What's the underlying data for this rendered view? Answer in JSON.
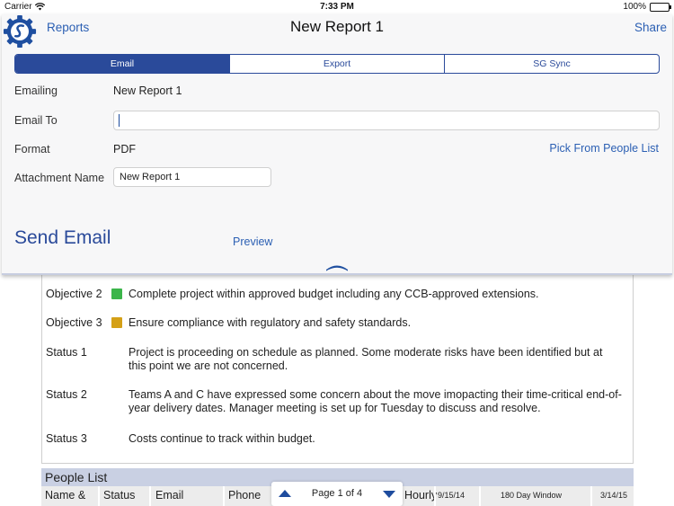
{
  "status_bar": {
    "carrier": "Carrier",
    "time": "7:33 PM",
    "battery": "100%"
  },
  "nav": {
    "back": "Reports",
    "title": "New Report 1",
    "share": "Share"
  },
  "tabs": [
    {
      "label": "Email",
      "active": true
    },
    {
      "label": "Export",
      "active": false
    },
    {
      "label": "SG Sync",
      "active": false
    }
  ],
  "form": {
    "emailing_label": "Emailing",
    "emailing_value": "New Report 1",
    "email_to_label": "Email To",
    "email_to_value": "",
    "format_label": "Format",
    "format_value": "PDF",
    "pick_from_people": "Pick From People List",
    "attachment_label": "Attachment Name",
    "attachment_value": "New Report 1"
  },
  "actions": {
    "send_email": "Send Email",
    "preview": "Preview"
  },
  "document": {
    "rows": [
      {
        "label": "Objective 2",
        "swatch": "#3bb54a",
        "text": "Complete project within approved budget including any CCB-approved extensions."
      },
      {
        "label": "Objective 3",
        "swatch": "#d4a017",
        "text": "Ensure compliance with regulatory and safety standards."
      },
      {
        "label": "Status 1",
        "text": "Project is proceeding on schedule as planned.  Some moderate risks have been identified but at this point we are not concerned."
      },
      {
        "label": "Status 2",
        "text": "Teams A and C have expressed some concern about the move imopacting their time-critical end-of-year delivery dates.  Manager meeting is set up for Tuesday to discuss and resolve."
      },
      {
        "label": "Status 3",
        "text": "Costs continue to track within budget."
      }
    ],
    "people_list_title": "People List",
    "columns": [
      "Name &",
      "Status",
      "Email",
      "Phone",
      "Hourly",
      "9/15/14",
      "180 Day Window",
      "3/14/15"
    ]
  },
  "pager": {
    "label": "Page 1 of 4"
  },
  "colors": {
    "accent": "#2a4a9a",
    "link": "#2b5fb3",
    "people_header": "#c9d0e3"
  },
  "icons": [
    "wifi-icon",
    "battery-icon",
    "app-logo-icon",
    "chevron-up-icon",
    "arrow-up-icon",
    "arrow-down-icon"
  ]
}
